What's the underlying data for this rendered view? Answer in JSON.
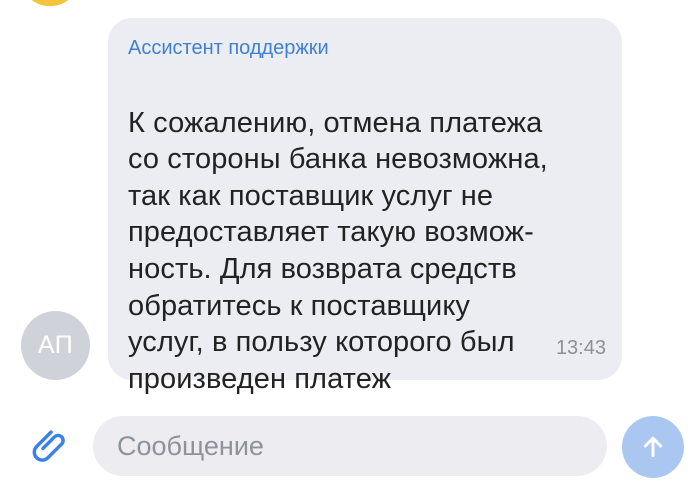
{
  "conversation": {
    "sender": "Ассистент поддержки",
    "message_lines": [
      "К сожалению, отмена платежа",
      "со стороны банка невозможна,",
      "так как поставщик услуг не",
      "предоставляет такую возмож-",
      "ность. Для возврата средств",
      "обратитесь к поставщику",
      "услуг, в пользу которого был",
      "произведен платеж"
    ],
    "time": "13:43",
    "avatar_initials": "АП"
  },
  "composer": {
    "placeholder": "Сообщение",
    "value": "",
    "attach_icon": "paperclip-icon",
    "send_icon": "arrow-up-icon"
  },
  "colors": {
    "bubble": "#ecedf2",
    "sender": "#3f80d3",
    "avatar": "#d0d2d9",
    "attach_icon": "#3b82e8",
    "send_button": "#a9c7f1",
    "input_background": "#ececf1"
  }
}
